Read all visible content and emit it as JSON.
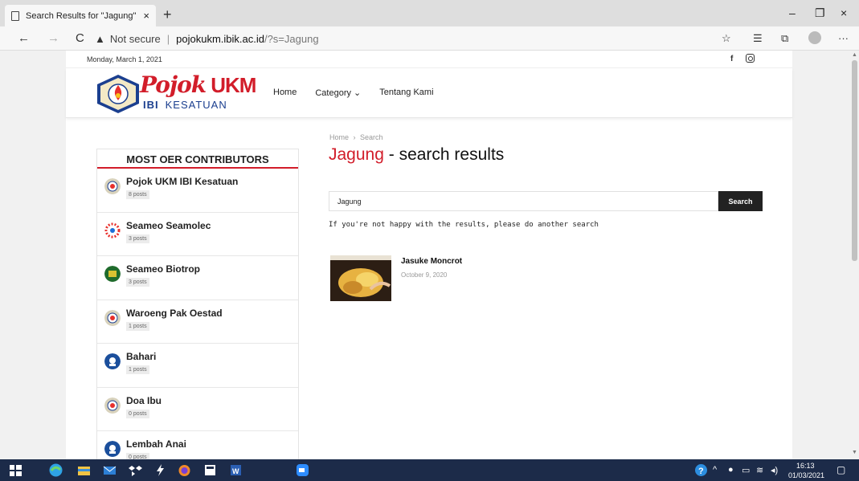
{
  "browser": {
    "tab_title": "Search Results for \"Jagung\" – Po",
    "tab_close": "×",
    "new_tab": "+",
    "minimize": "–",
    "restore": "❐",
    "close": "×",
    "back": "←",
    "forward": "→",
    "reload": "C",
    "warning": "▲",
    "not_secure": "Not secure",
    "separator": "|",
    "url_host": "pojokukm.ibik.ac.id",
    "url_path": "/?s=Jagung",
    "more": "···"
  },
  "topbar": {
    "date": "Monday, March 1, 2021",
    "facebook": "f"
  },
  "logo": {
    "main": "Pojok",
    "ukm": "UKM",
    "ibi": "IBI",
    "kesatuan": "KESATUAN"
  },
  "menu": {
    "home": "Home",
    "category": "Category ⌄",
    "about": "Tentang Kami"
  },
  "widget": {
    "title": "MOST OER CONTRIBUTORS",
    "authors": [
      {
        "name": "Pojok UKM IBI Kesatuan",
        "posts": "8 posts"
      },
      {
        "name": "Seameo Seamolec",
        "posts": "3 posts"
      },
      {
        "name": "Seameo Biotrop",
        "posts": "3 posts"
      },
      {
        "name": "Waroeng Pak Oestad",
        "posts": "1 posts"
      },
      {
        "name": "Bahari",
        "posts": "1 posts"
      },
      {
        "name": "Doa Ibu",
        "posts": "0 posts"
      },
      {
        "name": "Lembah Anai",
        "posts": "0 posts"
      }
    ]
  },
  "main": {
    "breadcrumb_home": "Home",
    "breadcrumb_sep": "›",
    "breadcrumb_current": "Search",
    "keyword": "Jagung",
    "title_suffix": " - search results",
    "search_value": "Jagung",
    "search_button": "Search",
    "hint": "If you're not happy with the results, please do another search",
    "result": {
      "title": "Jasuke Moncrot",
      "date": "October 9, 2020"
    }
  },
  "taskbar": {
    "time": "16:13",
    "date": "01/03/2021"
  },
  "colors": {
    "brand_red": "#d21d2a",
    "taskbar": "#1c2b49"
  }
}
